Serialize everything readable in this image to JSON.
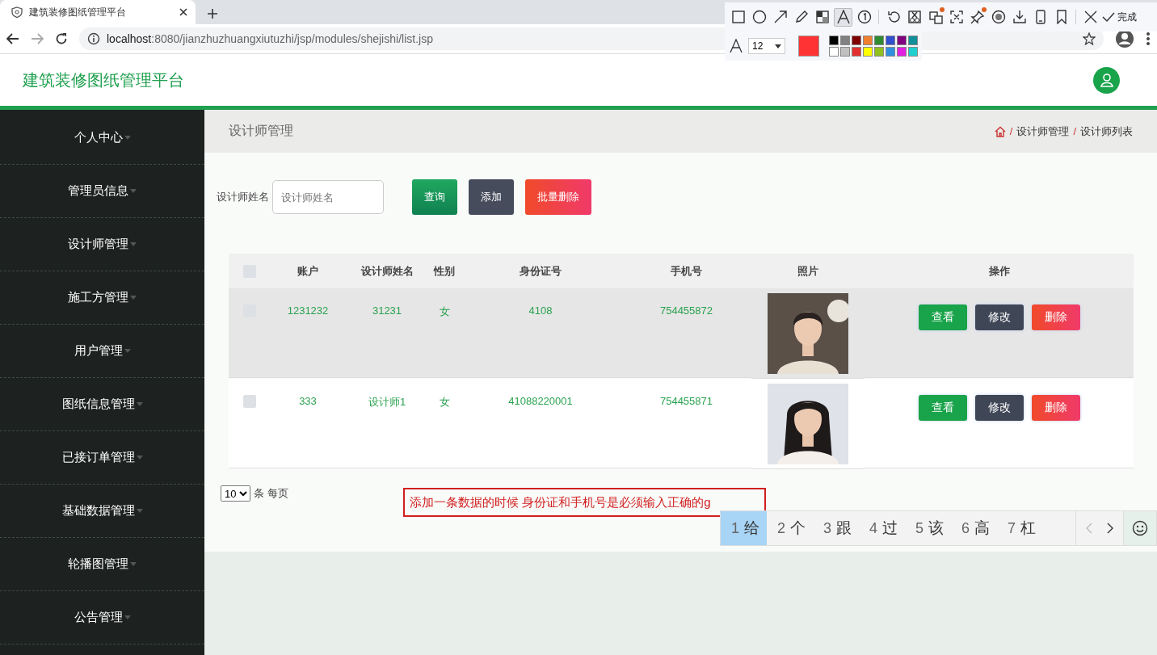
{
  "browser": {
    "tab_title": "建筑装修图纸管理平台",
    "url_host": "localhost",
    "url_rest": ":8080/jianzhuzhuangxiutuzhi/jsp/modules/shejishi/list.jsp"
  },
  "header": {
    "title": "建筑装修图纸管理平台"
  },
  "sidebar": {
    "items": [
      {
        "label": "个人中心"
      },
      {
        "label": "管理员信息"
      },
      {
        "label": "设计师管理"
      },
      {
        "label": "施工方管理"
      },
      {
        "label": "用户管理"
      },
      {
        "label": "图纸信息管理"
      },
      {
        "label": "已接订单管理"
      },
      {
        "label": "基础数据管理"
      },
      {
        "label": "轮播图管理"
      },
      {
        "label": "公告管理"
      }
    ]
  },
  "breadcrumb": {
    "page_title": "设计师管理",
    "separator": "/",
    "crumbs": [
      "设计师管理",
      "设计师列表"
    ]
  },
  "search": {
    "label": "设计师姓名",
    "placeholder": "设计师姓名",
    "buttons": [
      {
        "kind": "search",
        "label": "查询"
      },
      {
        "kind": "add",
        "label": "添加"
      },
      {
        "kind": "delete",
        "label": "批量删除"
      }
    ]
  },
  "table": {
    "all_checked": false,
    "columns": [
      "账户",
      "设计师姓名",
      "性别",
      "身份证号",
      "手机号",
      "照片",
      "操作"
    ],
    "rows": [
      {
        "checked": false,
        "highlighted": true,
        "cells": [
          "1231232",
          "31231",
          "女",
          "4108",
          "754455872"
        ],
        "actions": [
          {
            "kind": "view",
            "label": "查看"
          },
          {
            "kind": "edit",
            "label": "修改"
          },
          {
            "kind": "delete",
            "label": "删除"
          }
        ]
      },
      {
        "checked": false,
        "highlighted": false,
        "cells": [
          "333",
          "设计师1",
          "女",
          "41088220001",
          "754455871"
        ],
        "actions": [
          {
            "kind": "view",
            "label": "查看"
          },
          {
            "kind": "edit",
            "label": "修改"
          },
          {
            "kind": "delete",
            "label": "删除"
          }
        ]
      }
    ]
  },
  "pagination": {
    "page_size": "10",
    "suffix": "条 每页"
  },
  "annotation": {
    "text": "添加一条数据的时候 身份证和手机号是必须输入正确的g"
  },
  "annotation_toolbar": {
    "tools": [
      {
        "kind": "rect",
        "selected": false
      },
      {
        "kind": "ellipse",
        "selected": false
      },
      {
        "kind": "arrow",
        "selected": false
      },
      {
        "kind": "pencil",
        "selected": false
      },
      {
        "kind": "mosaic",
        "selected": false
      },
      {
        "kind": "text",
        "selected": true
      },
      {
        "kind": "number",
        "selected": false
      },
      {
        "kind": "sep"
      },
      {
        "kind": "undo",
        "selected": false
      },
      {
        "kind": "cut",
        "selected": false
      },
      {
        "kind": "translate",
        "selected": false,
        "badge": true
      },
      {
        "kind": "scan",
        "selected": false
      },
      {
        "kind": "pin",
        "selected": false,
        "badge": true
      },
      {
        "kind": "record",
        "selected": false
      },
      {
        "kind": "download",
        "selected": false
      },
      {
        "kind": "phone",
        "selected": false
      },
      {
        "kind": "bookmark",
        "selected": false
      },
      {
        "kind": "sep"
      },
      {
        "kind": "close",
        "selected": false
      }
    ],
    "done_label": "完成",
    "font_size": "12",
    "current": {
      "color": "#ff3333"
    },
    "palette": [
      {
        "color": "#000000"
      },
      {
        "color": "#808080"
      },
      {
        "color": "#800000"
      },
      {
        "color": "#f08030"
      },
      {
        "color": "#2e8b30"
      },
      {
        "color": "#3050d0"
      },
      {
        "color": "#800080"
      },
      {
        "color": "#10909a"
      },
      {
        "color": "#ffffff"
      },
      {
        "color": "#c0c0c0"
      },
      {
        "color": "#e03030"
      },
      {
        "color": "#ffff00"
      },
      {
        "color": "#90c020"
      },
      {
        "color": "#3090e0"
      },
      {
        "color": "#e020e0"
      },
      {
        "color": "#20d0d0"
      }
    ]
  },
  "ime": {
    "candidates": [
      {
        "number": "1",
        "char": "给",
        "selected": true
      },
      {
        "number": "2",
        "char": "个",
        "selected": false
      },
      {
        "number": "3",
        "char": "跟",
        "selected": false
      },
      {
        "number": "4",
        "char": "过",
        "selected": false
      },
      {
        "number": "5",
        "char": "该",
        "selected": false
      },
      {
        "number": "6",
        "char": "高",
        "selected": false
      },
      {
        "number": "7",
        "char": "杠",
        "selected": false
      }
    ]
  }
}
